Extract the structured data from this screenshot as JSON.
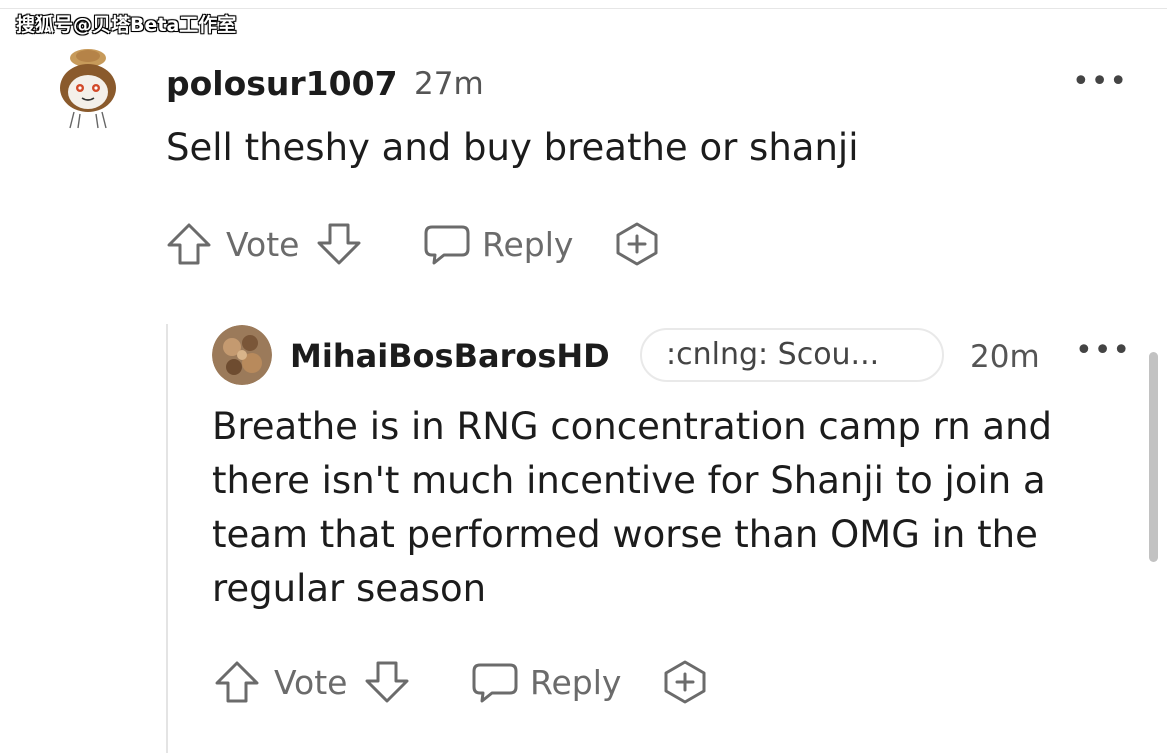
{
  "watermark": "搜狐号@贝塔Beta工作室",
  "comments": [
    {
      "author": "polosur1007",
      "time": "27m",
      "more_label": "•••",
      "body": "Sell theshy and buy breathe or shanji",
      "actions": {
        "vote_label": "Vote",
        "reply_label": "Reply"
      }
    },
    {
      "author": "MihaiBosBarosHD",
      "flair": ":cnlng: Scou...",
      "time": "20m",
      "more_label": "•••",
      "body_lines": [
        "Breathe is in RNG concentration camp rn and",
        "there isn't much incentive for Shanji to join a",
        "team that performed worse than OMG in the",
        "regular season"
      ],
      "actions": {
        "vote_label": "Vote",
        "reply_label": "Reply"
      }
    }
  ],
  "icons": {
    "upvote": "arrow-up-outline",
    "downvote": "arrow-down-outline",
    "reply": "speech-bubble-outline",
    "award": "hexagon-plus-outline",
    "more": "horizontal-ellipsis"
  },
  "colors": {
    "text": "#1c1c1c",
    "muted": "#6b6b6b",
    "thread_line": "#e4e4e4",
    "scrollbar": "#c2c2c2"
  }
}
